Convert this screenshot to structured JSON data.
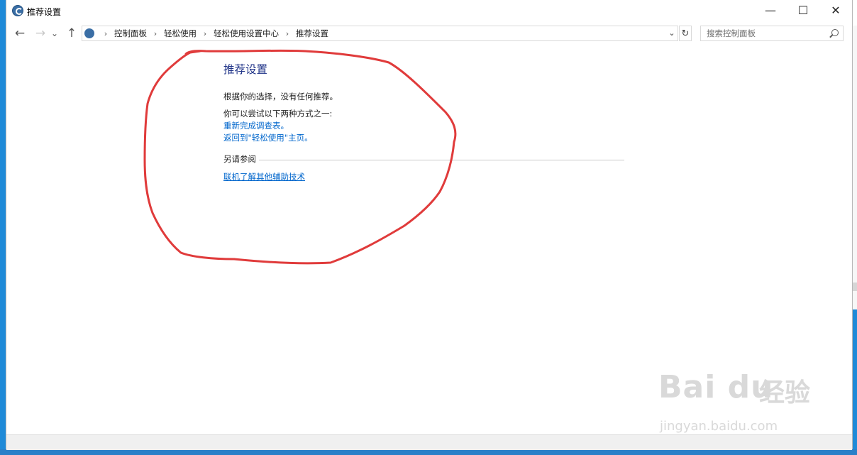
{
  "window": {
    "title": "推荐设置",
    "minimize_glyph": "—",
    "maximize_glyph": "☐",
    "close_glyph": "✕"
  },
  "nav": {
    "back_glyph": "←",
    "forward_glyph": "→",
    "recent_glyph": "⌄",
    "up_glyph": "↑"
  },
  "address": {
    "crumbs": [
      "控制面板",
      "轻松使用",
      "轻松使用设置中心",
      "推荐设置"
    ],
    "separator": "›",
    "dropdown_glyph": "⌄",
    "refresh_glyph": "↻"
  },
  "search": {
    "placeholder": "搜索控制面板"
  },
  "main": {
    "heading": "推荐设置",
    "no_recommendation": "根据你的选择，没有任何推荐。",
    "try_intro": "你可以尝试以下两种方式之一:",
    "link_redo": "重新完成调查表。",
    "link_home": "返回到\"轻松使用\"主页。",
    "see_also_label": "另请参阅",
    "link_more": "联机了解其他辅助技术"
  },
  "annotation": {
    "color": "#e03b3b"
  },
  "watermark": {
    "brand": "Bai du",
    "product": "经验",
    "url": "jingyan.baidu.com"
  },
  "colors": {
    "link": "#0066cc",
    "heading": "#1e3287",
    "desktop": "#1f8ad8"
  }
}
